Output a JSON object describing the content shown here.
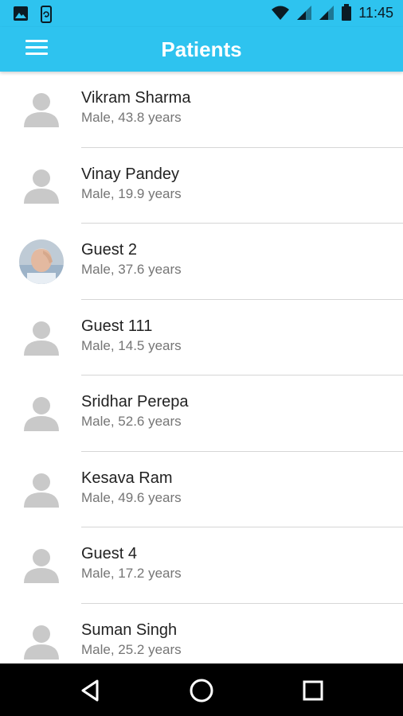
{
  "status_bar": {
    "time": "11:45",
    "icons": [
      "image-icon",
      "phone-sync-icon",
      "wifi-icon",
      "signal-icon",
      "signal-icon",
      "battery-icon"
    ]
  },
  "app_bar": {
    "title": "Patients",
    "menu_icon": "hamburger-menu-icon",
    "color": "#2ec3ef"
  },
  "patients": [
    {
      "name": "Vikram Sharma",
      "details": "Male, 43.8 years",
      "avatar": "placeholder"
    },
    {
      "name": "Vinay Pandey",
      "details": "Male, 19.9 years",
      "avatar": "placeholder"
    },
    {
      "name": "Guest 2",
      "details": "Male, 37.6 years",
      "avatar": "photo"
    },
    {
      "name": "Guest 111",
      "details": "Male, 14.5 years",
      "avatar": "placeholder"
    },
    {
      "name": "Sridhar Perepa",
      "details": "Male, 52.6 years",
      "avatar": "placeholder"
    },
    {
      "name": "Kesava Ram",
      "details": "Male, 49.6 years",
      "avatar": "placeholder"
    },
    {
      "name": "Guest 4",
      "details": "Male, 17.2 years",
      "avatar": "placeholder"
    },
    {
      "name": "Suman Singh",
      "details": "Male, 25.2 years",
      "avatar": "placeholder"
    }
  ],
  "nav_bar": {
    "buttons": [
      "back-icon",
      "home-icon",
      "recents-icon"
    ]
  }
}
